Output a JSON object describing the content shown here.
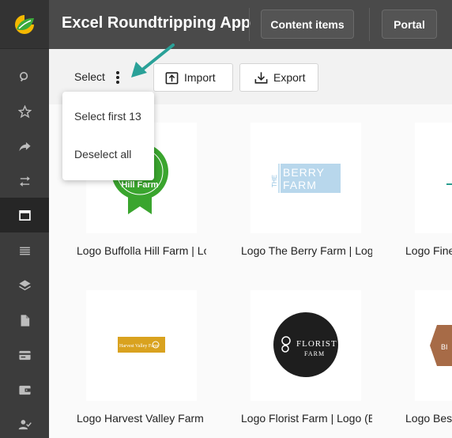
{
  "app": {
    "title": "Excel Roundtripping App",
    "accent": "#2aa198"
  },
  "header": {
    "content_items_label": "Content items",
    "portal_label": "Portal"
  },
  "sidebar": {
    "items": [
      {
        "icon": "search-icon"
      },
      {
        "icon": "star-icon"
      },
      {
        "icon": "share-icon"
      },
      {
        "icon": "swap-icon"
      },
      {
        "icon": "window-icon",
        "active": true
      },
      {
        "icon": "list-icon"
      },
      {
        "icon": "layers-icon"
      },
      {
        "icon": "document-icon"
      },
      {
        "icon": "card-icon"
      },
      {
        "icon": "wallet-icon"
      },
      {
        "icon": "user-check-icon"
      }
    ]
  },
  "toolbar": {
    "select_label": "Select",
    "import_label": "Import",
    "export_label": "Export"
  },
  "dropdown": {
    "items": [
      "Select first 13",
      "Deselect all"
    ]
  },
  "cards": [
    {
      "label": "Logo Buffolla Hill Farm | Lo",
      "logo_text": "Hill Farm"
    },
    {
      "label": "Logo The Berry Farm | Log",
      "logo_text_top": "BERRY",
      "logo_text_bottom": "FARM",
      "logo_side": "THE"
    },
    {
      "label": "Logo Fine"
    },
    {
      "label": "Logo Harvest Valley Farm",
      "logo_text": "Harvest Valley Farm"
    },
    {
      "label": "Logo Florist Farm | Logo (E",
      "logo_text_top": "FLORIST",
      "logo_text_bottom": "FARM"
    },
    {
      "label": "Logo Best",
      "logo_text": "BI"
    }
  ]
}
